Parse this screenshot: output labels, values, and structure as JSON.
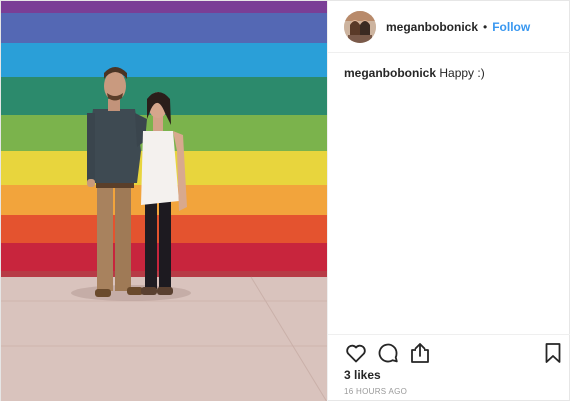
{
  "header": {
    "username": "meganbobonick",
    "separator": "•",
    "follow_label": "Follow"
  },
  "caption": {
    "username": "meganbobonick",
    "text": "Happy :)"
  },
  "actions": {
    "like_icon": "heart-icon",
    "comment_icon": "comment-icon",
    "share_icon": "share-icon",
    "save_icon": "bookmark-icon"
  },
  "likes": {
    "text": "3 likes"
  },
  "timestamp": {
    "text": "16 HOURS AGO"
  },
  "colors": {
    "link": "#3897f0",
    "text": "#262626",
    "muted": "#999999",
    "stripes": [
      "#6a3f9a",
      "#4a6fb8",
      "#2d9fd6",
      "#2f8b6b",
      "#7fb24a",
      "#e5d43a",
      "#f1a53a",
      "#e2512f",
      "#c7243b"
    ]
  }
}
